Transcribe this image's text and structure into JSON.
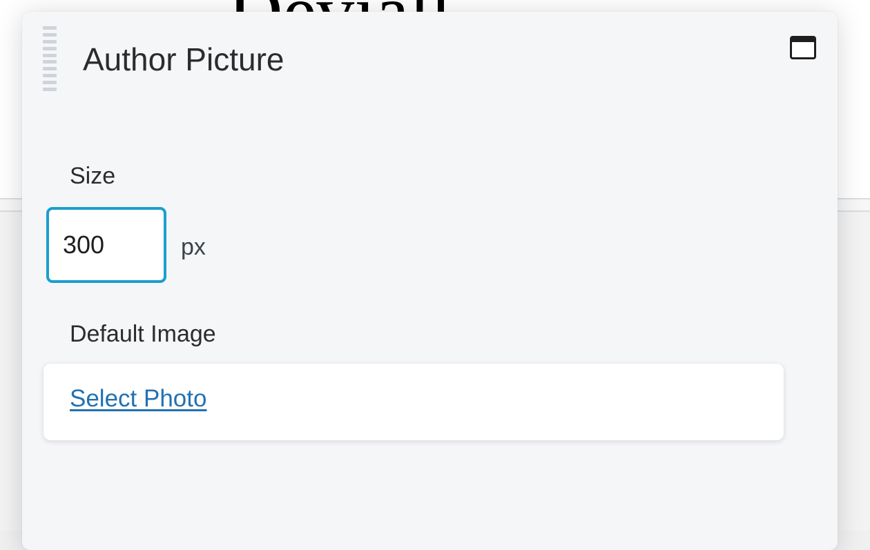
{
  "background": {
    "heading_fragment": "Deviall"
  },
  "panel": {
    "title": "Author Picture",
    "icons": {
      "drag_handle": "drag-handle-icon",
      "window_toggle": "window-icon"
    }
  },
  "size": {
    "label": "Size",
    "value": "300",
    "unit": "px"
  },
  "default_image": {
    "label": "Default Image",
    "select_label": "Select Photo"
  },
  "colors": {
    "accent_focus": "#1a9fce",
    "link": "#2271b1",
    "panel_bg": "#f5f6f8"
  }
}
